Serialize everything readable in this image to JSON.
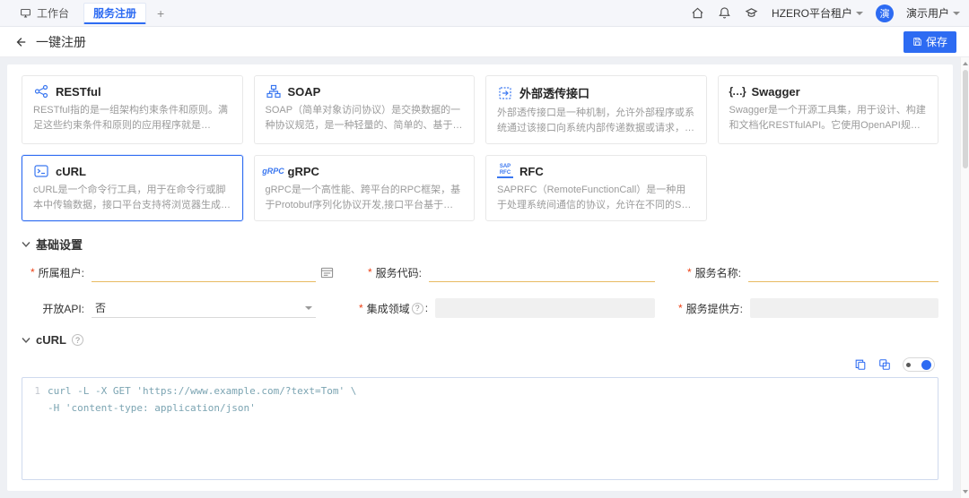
{
  "topbar": {
    "workbench_tab": "工作台",
    "active_tab": "服务注册",
    "add_tab": "+",
    "tenant_label": "HZERO平台租户",
    "user_label": "演示用户",
    "avatar_text": "演"
  },
  "header": {
    "title": "一键注册",
    "save": "保存"
  },
  "cards": [
    {
      "name": "RESTful",
      "desc": "RESTful指的是一组架构约束条件和原则。满足这些约束条件和原则的应用程序就是RESTful。其特点包括：1、每一..."
    },
    {
      "name": "SOAP",
      "desc": "SOAP（简单对象访问协议）是交换数据的一种协议规范，是一种轻量的、简单的、基于XML（标准通用标记语言下..."
    },
    {
      "name": "外部透传接口",
      "desc": "外部透传接口是一种机制，允许外部程序或系统通过该接口向系统内部传递数据或请求，并获取相应的响应结果。外..."
    },
    {
      "name": "Swagger",
      "desc": "Swagger是一个开源工具集，用于设计、构建和文档化RESTfulAPI。它使用OpenAPI规范描述API的结构和操作，并..."
    },
    {
      "name": "cURL",
      "desc": "cURL是一个命令行工具，用于在命令行或脚本中传输数据，接口平台支持将浏览器生成或接口调用工具生成的cU..."
    },
    {
      "name": "gRPC",
      "desc": "gRPC是一个高性能、跨平台的RPC框架，基于Protobuf序列化协议开发,接口平台基于反射机制获取gRPC服务端的..."
    },
    {
      "name": "RFC",
      "desc": "SAPRFC（RemoteFunctionCall）是一种用于处理系统间通信的协议，允许在不同的SAP系统之间以及SAP与外部..."
    }
  ],
  "icon_text": {
    "swagger": "{…}",
    "grpc": "gRPC",
    "rfc": "SAP\nRFC"
  },
  "marks": {
    "required": "*",
    "help": "?"
  },
  "basic": {
    "section_title": "基础设置",
    "tenant_label": "所属租户:",
    "code_label": "服务代码:",
    "name_label": "服务名称:",
    "open_api_label": "开放API:",
    "open_api_value": "否",
    "domain_label": "集成领域",
    "domain_colon": ":",
    "provider_label": "服务提供方:"
  },
  "curl": {
    "section_title": "cURL",
    "line_number": "1",
    "line1": "curl -L -X GET 'https://www.example.com/?text=Tom' \\",
    "line2": "-H 'content-type: application/json'"
  }
}
